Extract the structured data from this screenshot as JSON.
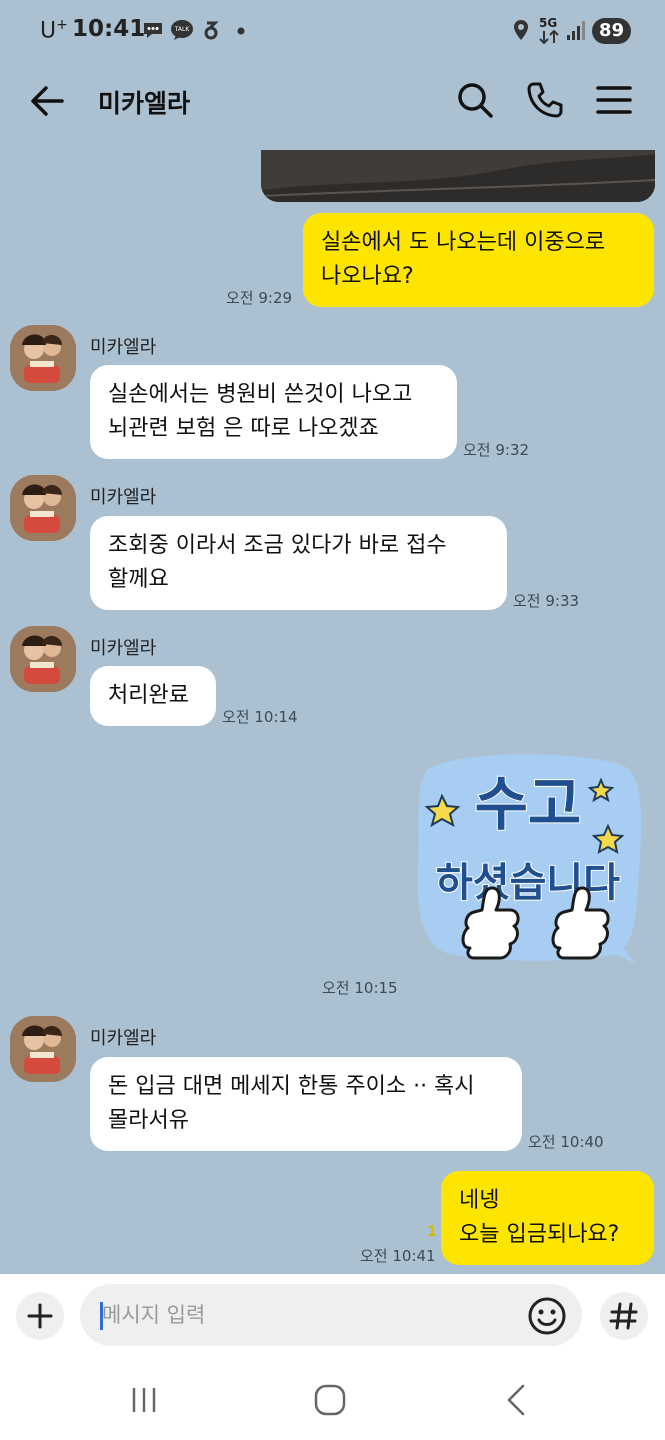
{
  "status_bar": {
    "carrier": "U",
    "carrier_sup": "+",
    "time": "10:41",
    "network": "5G",
    "battery": "89"
  },
  "header": {
    "title": "미카엘라",
    "icons": [
      "back-arrow-icon",
      "search-icon",
      "phone-icon",
      "menu-icon"
    ]
  },
  "messages": [
    {
      "type": "out",
      "text": "실손에서 도 나오는데 이중으로\n나오나요?",
      "time": "오전 9:29"
    },
    {
      "type": "in",
      "sender": "미카엘라",
      "text": "실손에서는 병원비 쓴것이 나오고\n뇌관련 보험 은 따로 나오겠죠",
      "time": "오전 9:32"
    },
    {
      "type": "in",
      "sender": "미카엘라",
      "text": "조회중 이라서 조금 있다가 바로  접수\n할께요",
      "time": "오전 9:33"
    },
    {
      "type": "in",
      "sender": "미카엘라",
      "text": "처리완료",
      "time": "오전 10:14"
    },
    {
      "type": "sticker",
      "sticker_line1": "수고",
      "sticker_line2": "하셨습니다",
      "time": "오전 10:15"
    },
    {
      "type": "in",
      "sender": "미카엘라",
      "text": "돈 입금 대면 메세지 한통 주이소 ·· 혹시\n몰라서유",
      "time": "오전 10:40"
    },
    {
      "type": "out",
      "text": "네넹\n오늘 입금되나요?",
      "time": "오전 10:41",
      "unread": "1"
    }
  ],
  "input": {
    "placeholder": "메시지 입력"
  },
  "colors": {
    "background": "#abc1d1",
    "outgoing_bubble": "#fee500",
    "incoming_bubble": "#ffffff"
  }
}
